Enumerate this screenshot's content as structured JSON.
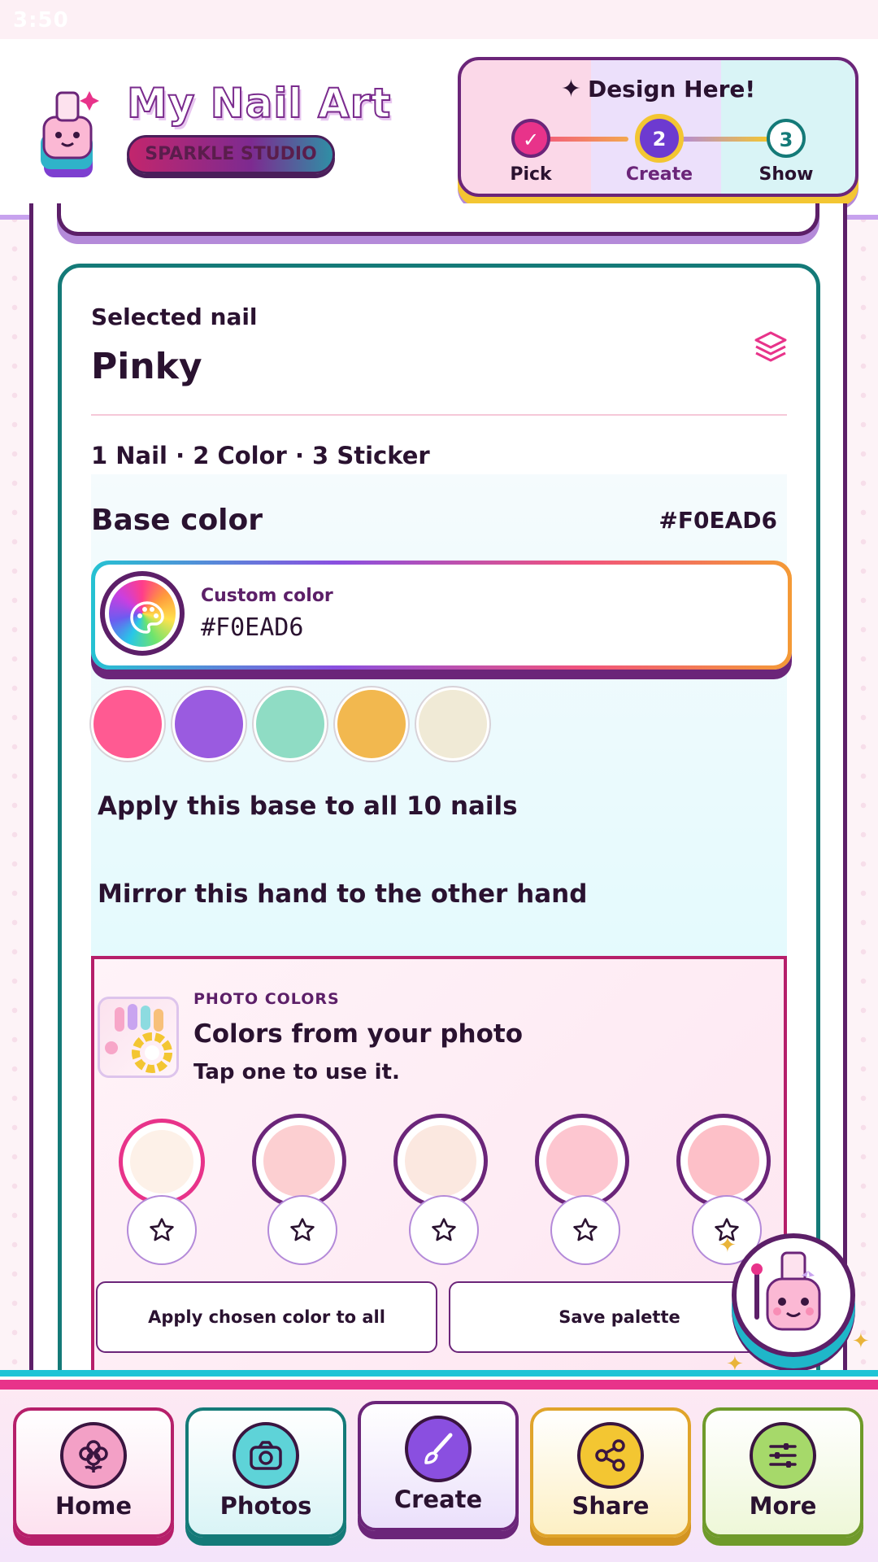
{
  "status_bar": {
    "time": "3:50"
  },
  "header": {
    "title": "My Nail Art",
    "subtitle": "SPARKLE STUDIO",
    "stepper": {
      "title": "Design Here!",
      "steps": [
        {
          "label": "Pick",
          "mark": "✓",
          "state": "done"
        },
        {
          "label": "Create",
          "mark": "2",
          "state": "current"
        },
        {
          "label": "Show",
          "mark": "3",
          "state": "upcoming"
        }
      ]
    }
  },
  "nail": {
    "selected_label": "Selected nail",
    "selected_name": "Pinky",
    "summary": "1 Nail · 2 Color · 3 Sticker"
  },
  "base_color": {
    "title": "Base color",
    "hex": "#F0EAD6",
    "custom_label": "Custom color",
    "custom_value": "#F0EAD6",
    "swatches": [
      "#ff5a92",
      "#9a5be0",
      "#8fdcc4",
      "#f2b84f",
      "#f0ead6"
    ],
    "apply_all_label": "Apply this base to all 10 nails",
    "mirror_label": "Mirror this hand to the other hand"
  },
  "photo_colors": {
    "kicker": "PHOTO COLORS",
    "title": "Colors from your photo",
    "subtitle": "Tap one to use it.",
    "colors": [
      {
        "hex": "#fdf1e8",
        "selected": true
      },
      {
        "hex": "#fccfd1",
        "selected": false
      },
      {
        "hex": "#fbe8e0",
        "selected": false
      },
      {
        "hex": "#fdc6d0",
        "selected": false
      },
      {
        "hex": "#fdc0c8",
        "selected": false
      }
    ],
    "apply_chosen_label": "Apply chosen color to all",
    "save_palette_label": "Save palette"
  },
  "nav": {
    "items": [
      {
        "label": "Home",
        "icon": "flower-icon",
        "active": false
      },
      {
        "label": "Photos",
        "icon": "camera-icon",
        "active": false
      },
      {
        "label": "Create",
        "icon": "brush-icon",
        "active": true
      },
      {
        "label": "Share",
        "icon": "share-icon",
        "active": false
      },
      {
        "label": "More",
        "icon": "sliders-icon",
        "active": false
      }
    ]
  },
  "colors": {
    "accent_pink": "#e8338a",
    "accent_purple": "#5c1f68",
    "accent_teal": "#147a78",
    "accent_yellow": "#f3c632"
  }
}
